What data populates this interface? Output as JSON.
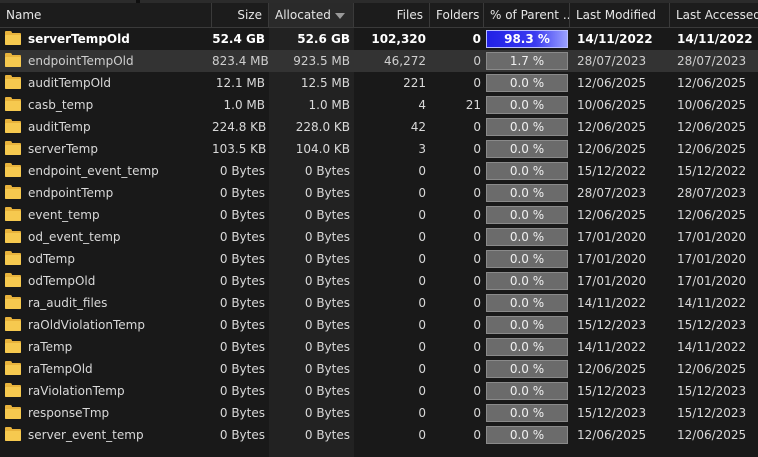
{
  "columns": {
    "name": "Name",
    "size": "Size",
    "allocated": "Allocated",
    "files": "Files",
    "folders": "Folders",
    "percent": "% of Parent ...",
    "modified": "Last Modified",
    "accessed": "Last Accessed"
  },
  "colors": {
    "folder": "#f6c94f",
    "percent_highlight": "#2121e6",
    "percent_normal": "#6b6b6b"
  },
  "rows": [
    {
      "name": "serverTempOld",
      "size": "52.4 GB",
      "allocated": "52.6 GB",
      "files": "102,320",
      "folders": "0",
      "percent": "98.3 %",
      "modified": "14/11/2022",
      "accessed": "14/11/2022",
      "bold": true,
      "highlight": true
    },
    {
      "name": "endpointTempOld",
      "size": "823.4 MB",
      "allocated": "923.5 MB",
      "files": "46,272",
      "folders": "0",
      "percent": "1.7 %",
      "modified": "28/07/2023",
      "accessed": "28/07/2023",
      "selected": true
    },
    {
      "name": "auditTempOld",
      "size": "12.1 MB",
      "allocated": "12.5 MB",
      "files": "221",
      "folders": "0",
      "percent": "0.0 %",
      "modified": "12/06/2025",
      "accessed": "12/06/2025"
    },
    {
      "name": "casb_temp",
      "size": "1.0 MB",
      "allocated": "1.0 MB",
      "files": "4",
      "folders": "21",
      "percent": "0.0 %",
      "modified": "10/06/2025",
      "accessed": "10/06/2025"
    },
    {
      "name": "auditTemp",
      "size": "224.8 KB",
      "allocated": "228.0 KB",
      "files": "42",
      "folders": "0",
      "percent": "0.0 %",
      "modified": "12/06/2025",
      "accessed": "12/06/2025"
    },
    {
      "name": "serverTemp",
      "size": "103.5 KB",
      "allocated": "104.0 KB",
      "files": "3",
      "folders": "0",
      "percent": "0.0 %",
      "modified": "12/06/2025",
      "accessed": "12/06/2025"
    },
    {
      "name": "endpoint_event_temp",
      "size": "0 Bytes",
      "allocated": "0 Bytes",
      "files": "0",
      "folders": "0",
      "percent": "0.0 %",
      "modified": "15/12/2022",
      "accessed": "15/12/2022"
    },
    {
      "name": "endpointTemp",
      "size": "0 Bytes",
      "allocated": "0 Bytes",
      "files": "0",
      "folders": "0",
      "percent": "0.0 %",
      "modified": "28/07/2023",
      "accessed": "28/07/2023"
    },
    {
      "name": "event_temp",
      "size": "0 Bytes",
      "allocated": "0 Bytes",
      "files": "0",
      "folders": "0",
      "percent": "0.0 %",
      "modified": "12/06/2025",
      "accessed": "12/06/2025"
    },
    {
      "name": "od_event_temp",
      "size": "0 Bytes",
      "allocated": "0 Bytes",
      "files": "0",
      "folders": "0",
      "percent": "0.0 %",
      "modified": "17/01/2020",
      "accessed": "17/01/2020"
    },
    {
      "name": "odTemp",
      "size": "0 Bytes",
      "allocated": "0 Bytes",
      "files": "0",
      "folders": "0",
      "percent": "0.0 %",
      "modified": "17/01/2020",
      "accessed": "17/01/2020"
    },
    {
      "name": "odTempOld",
      "size": "0 Bytes",
      "allocated": "0 Bytes",
      "files": "0",
      "folders": "0",
      "percent": "0.0 %",
      "modified": "17/01/2020",
      "accessed": "17/01/2020"
    },
    {
      "name": "ra_audit_files",
      "size": "0 Bytes",
      "allocated": "0 Bytes",
      "files": "0",
      "folders": "0",
      "percent": "0.0 %",
      "modified": "14/11/2022",
      "accessed": "14/11/2022"
    },
    {
      "name": "raOldViolationTemp",
      "size": "0 Bytes",
      "allocated": "0 Bytes",
      "files": "0",
      "folders": "0",
      "percent": "0.0 %",
      "modified": "15/12/2023",
      "accessed": "15/12/2023"
    },
    {
      "name": "raTemp",
      "size": "0 Bytes",
      "allocated": "0 Bytes",
      "files": "0",
      "folders": "0",
      "percent": "0.0 %",
      "modified": "14/11/2022",
      "accessed": "14/11/2022"
    },
    {
      "name": "raTempOld",
      "size": "0 Bytes",
      "allocated": "0 Bytes",
      "files": "0",
      "folders": "0",
      "percent": "0.0 %",
      "modified": "12/06/2025",
      "accessed": "12/06/2025"
    },
    {
      "name": "raViolationTemp",
      "size": "0 Bytes",
      "allocated": "0 Bytes",
      "files": "0",
      "folders": "0",
      "percent": "0.0 %",
      "modified": "15/12/2023",
      "accessed": "15/12/2023"
    },
    {
      "name": "responseTmp",
      "size": "0 Bytes",
      "allocated": "0 Bytes",
      "files": "0",
      "folders": "0",
      "percent": "0.0 %",
      "modified": "15/12/2023",
      "accessed": "15/12/2023"
    },
    {
      "name": "server_event_temp",
      "size": "0 Bytes",
      "allocated": "0 Bytes",
      "files": "0",
      "folders": "0",
      "percent": "0.0 %",
      "modified": "12/06/2025",
      "accessed": "12/06/2025"
    }
  ]
}
